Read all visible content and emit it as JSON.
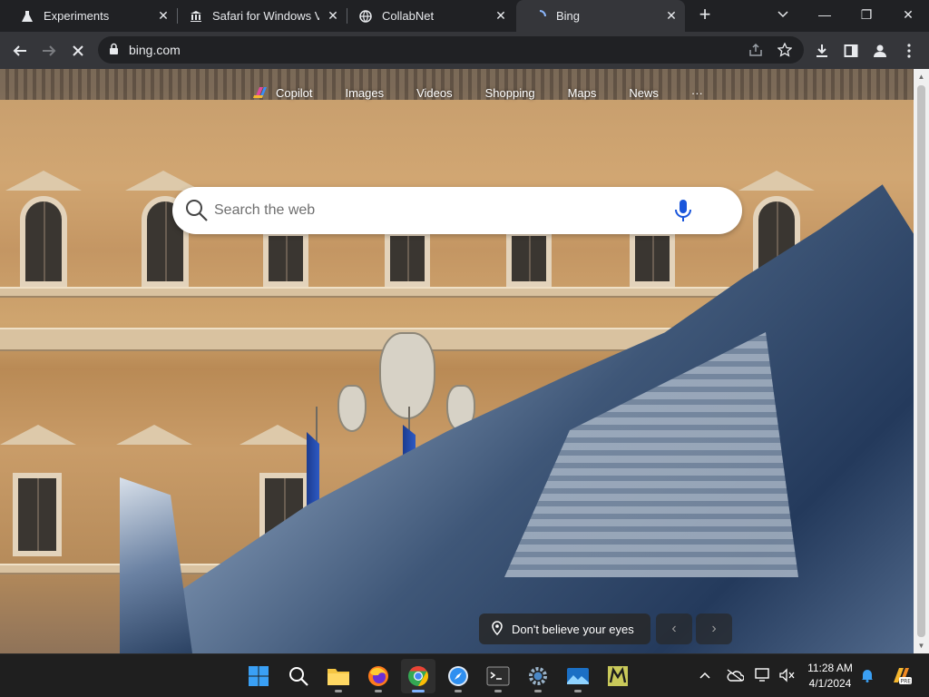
{
  "browser": {
    "tabs": [
      {
        "title": "Experiments",
        "icon": "flask-icon",
        "active": false
      },
      {
        "title": "Safari for Windows Ve",
        "icon": "bank-icon",
        "active": false
      },
      {
        "title": "CollabNet",
        "icon": "globe-icon",
        "active": false
      },
      {
        "title": "Bing",
        "icon": "loading-icon",
        "active": true
      }
    ],
    "new_tab": "+",
    "url": "bing.com",
    "window_controls": {
      "minimize": "—",
      "maximize": "❐",
      "close": "✕"
    }
  },
  "bing": {
    "nav": [
      "Copilot",
      "Images",
      "Videos",
      "Shopping",
      "Maps",
      "News",
      "···"
    ],
    "search_placeholder": "Search the web",
    "caption": "Don't believe your eyes",
    "prev_arrow": "‹",
    "next_arrow": "›"
  },
  "taskbar": {
    "apps": [
      {
        "name": "start",
        "icon": "windows-logo-icon"
      },
      {
        "name": "search",
        "icon": "search-icon"
      },
      {
        "name": "file-explorer",
        "icon": "folder-icon"
      },
      {
        "name": "firefox",
        "icon": "firefox-icon"
      },
      {
        "name": "chrome",
        "icon": "chrome-icon",
        "active": true
      },
      {
        "name": "safari",
        "icon": "compass-icon"
      },
      {
        "name": "terminal",
        "icon": "terminal-icon"
      },
      {
        "name": "settings",
        "icon": "gear-icon"
      },
      {
        "name": "photos",
        "icon": "photos-icon"
      },
      {
        "name": "app-m",
        "icon": "m-logo-icon"
      }
    ],
    "time": "11:28 AM",
    "date": "4/1/2024"
  },
  "colors": {
    "tab_bg": "#202124",
    "toolbar_bg": "#35363a",
    "taskbar_bg": "#1f1f1f",
    "accent": "#7fb3ff"
  }
}
